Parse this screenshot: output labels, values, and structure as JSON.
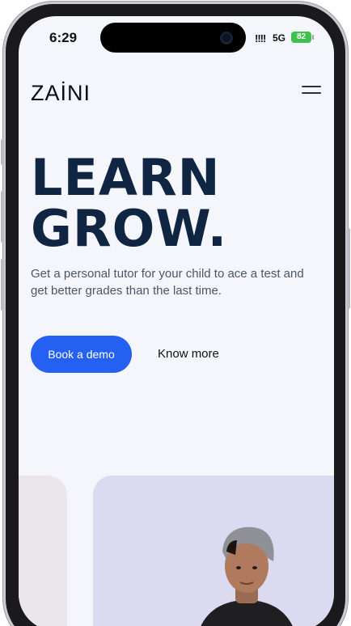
{
  "status_bar": {
    "time": "6:29",
    "signal": "!!!!",
    "network": "5G",
    "battery": "82"
  },
  "header": {
    "logo": "ZAİNI"
  },
  "hero": {
    "headline_line1": "LEARN",
    "headline_line2": "GROW.",
    "subtitle": "Get a personal tutor for your child to ace a test and get better grades than the last time.",
    "primary_button": "Book a demo",
    "secondary_link": "Know more"
  },
  "colors": {
    "accent": "#2461f2",
    "headline": "#0f2542",
    "background": "#f4f6fb",
    "card_right": "#dcdaf1",
    "card_left": "#ebe6eb"
  },
  "icons": {
    "menu": "hamburger-menu-icon",
    "camera": "front-camera-icon"
  }
}
